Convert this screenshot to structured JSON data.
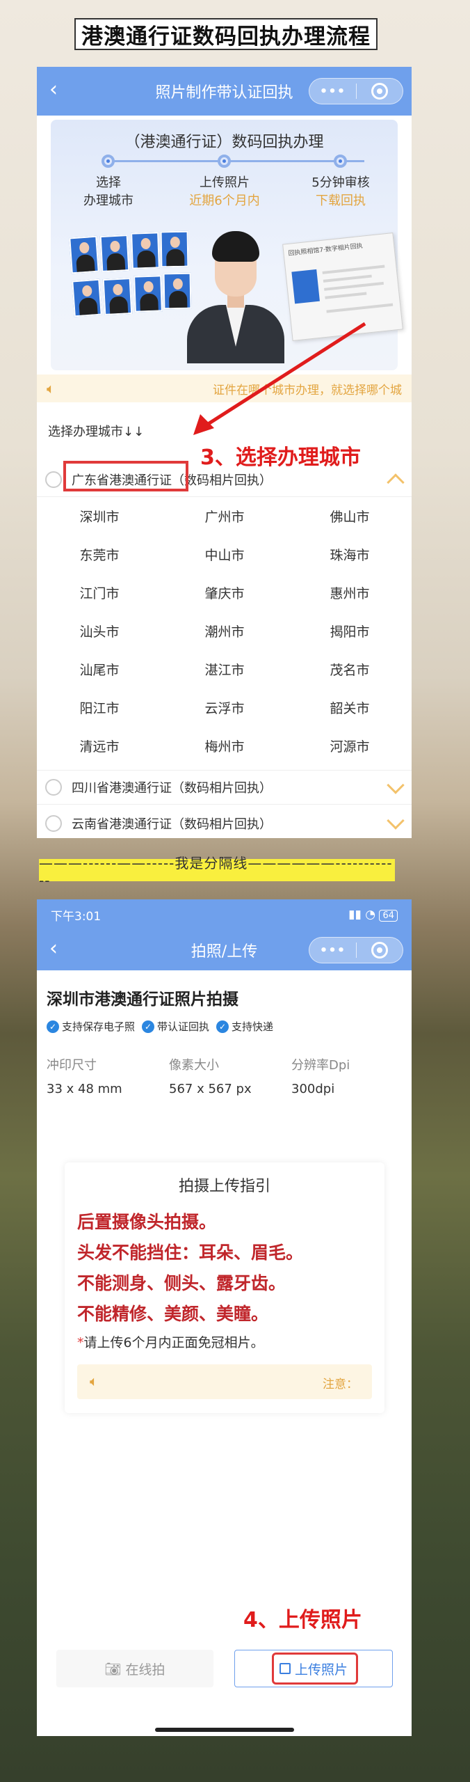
{
  "banner": {
    "title": "港澳通行证数码回执办理流程"
  },
  "screen1": {
    "nav": {
      "back": "‹",
      "title": "照片制作带认证回执",
      "capsule_more": "•••"
    },
    "flow": {
      "title": "（港澳通行证）数码回执办理",
      "steps": [
        {
          "line1": "选择",
          "line2": "办理城市"
        },
        {
          "line1": "上传照片",
          "line2": "近期6个月内"
        },
        {
          "line1": "5分钟审核",
          "line2": "下载回执"
        }
      ],
      "receipt_title": "回执照相馆7·数字相片回执"
    },
    "notice": "证件在哪个城市办理，就选择哪个城",
    "select_label": "选择办理城市↓↓",
    "provinces": [
      {
        "name": "广东省港澳通行证（数码相片回执）",
        "expanded": true
      },
      {
        "name": "四川省港澳通行证（数码相片回执）",
        "expanded": false
      },
      {
        "name": "云南省港澳通行证（数码相片回执）",
        "expanded": false
      }
    ],
    "cities": [
      [
        "深圳市",
        "广州市",
        "佛山市"
      ],
      [
        "东莞市",
        "中山市",
        "珠海市"
      ],
      [
        "江门市",
        "肇庆市",
        "惠州市"
      ],
      [
        "汕头市",
        "潮州市",
        "揭阳市"
      ],
      [
        "汕尾市",
        "湛江市",
        "茂名市"
      ],
      [
        "阳江市",
        "云浮市",
        "韶关市"
      ],
      [
        "清远市",
        "梅州市",
        "河源市"
      ]
    ],
    "annotation": "3、选择办理城市"
  },
  "divider": "———------——-----我是分隔线——————------------",
  "screen2": {
    "status": {
      "time": "下午3:01",
      "battery": "64"
    },
    "nav": {
      "back": "‹",
      "title": "拍照/上传",
      "capsule_more": "•••"
    },
    "title": "深圳市港澳通行证照片拍摄",
    "tags": [
      "支持保存电子照",
      "带认证回执",
      "支持快递"
    ],
    "specs": [
      {
        "label": "冲印尺寸",
        "value": "33 x 48 mm"
      },
      {
        "label": "像素大小",
        "value": "567 x 567 px"
      },
      {
        "label": "分辨率Dpi",
        "value": "300dpi"
      }
    ],
    "guide": {
      "title": "拍摄上传指引",
      "rules": [
        "后置摄像头拍摄。",
        "头发不能挡住：耳朵、眉毛。",
        "不能测身、侧头、露牙齿。",
        "不能精修、美颜、美瞳。"
      ],
      "note_star": "*",
      "note": "请上传6个月内正面免冠相片。",
      "notice": "注意："
    },
    "annotation": "4、上传照片",
    "buttons": {
      "camera": "在线拍",
      "upload": "上传照片"
    }
  }
}
